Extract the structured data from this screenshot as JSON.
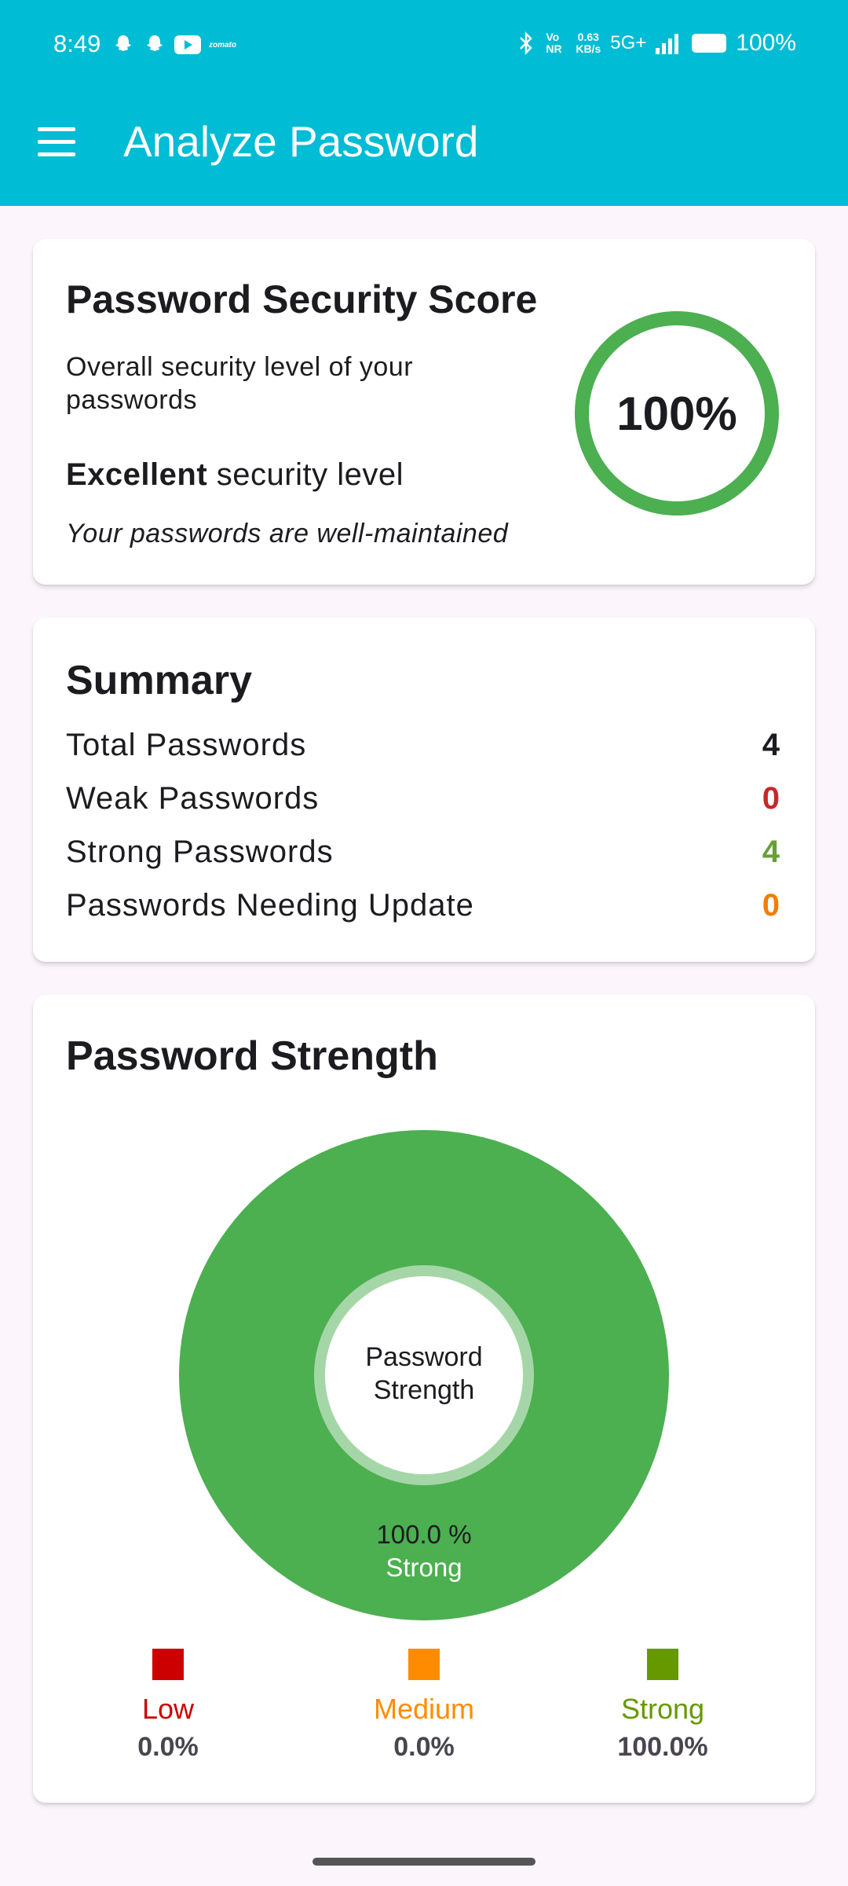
{
  "status_bar": {
    "time": "8:49",
    "notification_icons": [
      "snapchat-icon",
      "snapchat-icon",
      "youtube-icon",
      "zomato-icon"
    ],
    "zomato_text": "zomato",
    "volte": "Vo NR",
    "net_speed_value": "0.63",
    "net_speed_unit": "KB/s",
    "network": "5G+",
    "battery": "100%"
  },
  "app_bar": {
    "title": "Analyze Password",
    "menu_icon": "hamburger-menu-icon"
  },
  "score_card": {
    "title": "Password Security Score",
    "subtitle": "Overall security level of your passwords",
    "level_strong": "Excellent",
    "level_rest": " security level",
    "note": "Your passwords are well-maintained",
    "score_label": "100%",
    "score_value": 1.0,
    "ring_color": "#4caf50"
  },
  "summary": {
    "title": "Summary",
    "rows": [
      {
        "label": "Total Passwords",
        "value": "4",
        "color": "#1c1b1f"
      },
      {
        "label": "Weak Passwords",
        "value": "0",
        "color": "#c62828"
      },
      {
        "label": "Strong Passwords",
        "value": "4",
        "color": "#689f38"
      },
      {
        "label": "Passwords Needing Update",
        "value": "0",
        "color": "#f57c00"
      }
    ]
  },
  "strength": {
    "title": "Password Strength",
    "center_line1": "Password",
    "center_line2": "Strength",
    "slice_percent_label": "100.0 %",
    "slice_name_label": "Strong"
  },
  "chart_data": {
    "type": "pie",
    "title": "Password Strength",
    "categories": [
      "Low",
      "Medium",
      "Strong"
    ],
    "values": [
      0.0,
      0.0,
      100.0
    ],
    "percent_labels": [
      "0.0%",
      "0.0%",
      "100.0%"
    ],
    "colors": [
      "#cc0000",
      "#ff8c00",
      "#669900"
    ],
    "slice_color": "#4caf50",
    "legend_position": "bottom"
  }
}
